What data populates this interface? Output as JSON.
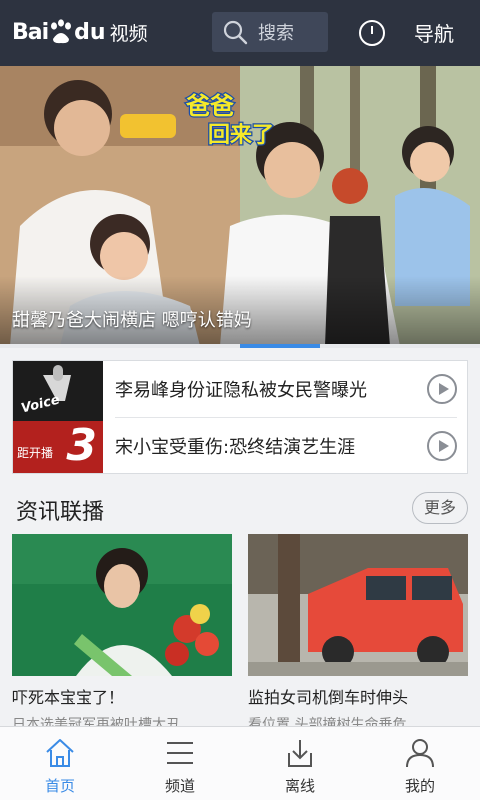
{
  "header": {
    "logo_bai": "Bai",
    "logo_du": "du",
    "logo_video": "视频",
    "search_placeholder": "搜索",
    "nav_label": "导航"
  },
  "banner": {
    "caption": "甜馨乃爸大闹横店 嗯哼认错妈",
    "badge_line1": "爸爸",
    "badge_line2": "回来了"
  },
  "hot": {
    "image_voice": "Voice",
    "image_pre": "距开播",
    "image_digit": "3",
    "items": [
      {
        "title": "李易峰身份证隐私被女民警曝光"
      },
      {
        "title": "宋小宝受重伤:恐终结演艺生涯"
      }
    ]
  },
  "section": {
    "title": "资讯联播",
    "more": "更多"
  },
  "news": [
    {
      "title": "吓死本宝宝了！",
      "subtitle": "日本选美冠军再被吐槽太丑"
    },
    {
      "title": "监拍女司机倒车时伸头",
      "subtitle": "看位置 头部撞树生命垂危"
    }
  ],
  "tabs": [
    {
      "label": "首页",
      "icon": "home-icon"
    },
    {
      "label": "频道",
      "icon": "list-icon"
    },
    {
      "label": "离线",
      "icon": "download-icon"
    },
    {
      "label": "我的",
      "icon": "user-icon"
    }
  ],
  "colors": {
    "header_bg": "#2d3340",
    "accent": "#3a8be6",
    "page_bg": "#f1f2f4"
  }
}
